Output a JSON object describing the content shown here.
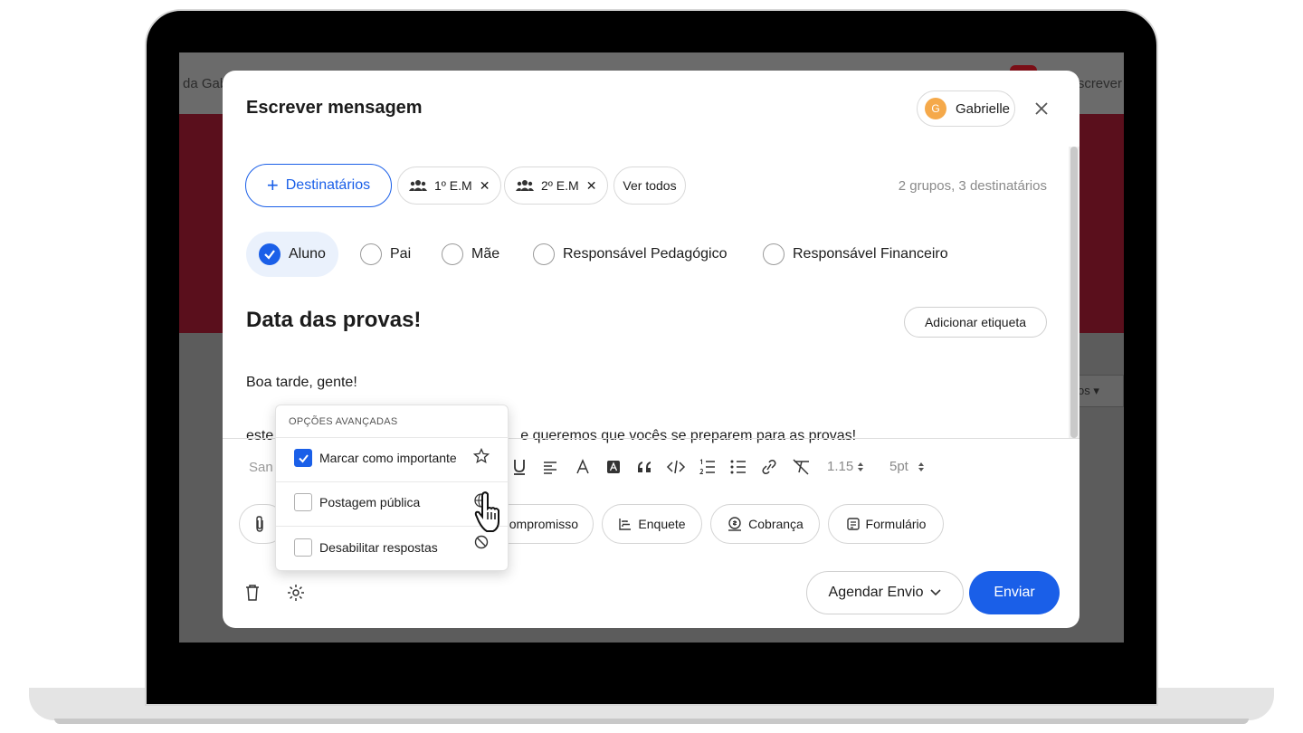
{
  "background": {
    "left_text": "da Gab",
    "right_text": "screver",
    "select_fragment": "os"
  },
  "modal": {
    "title": "Escrever mensagem",
    "user": {
      "avatar_initial": "G",
      "name": "Gabrielle"
    },
    "add_recipients_label": "Destinatários",
    "groups": [
      {
        "label": "1º E.M"
      },
      {
        "label": "2º E.M"
      }
    ],
    "see_all_label": "Ver todos",
    "recipients_summary": "2 grupos, 3 destinatários",
    "roles": [
      {
        "label": "Aluno",
        "checked": true
      },
      {
        "label": "Pai",
        "checked": false
      },
      {
        "label": "Mãe",
        "checked": false
      },
      {
        "label": "Responsável Pedagógico",
        "checked": false
      },
      {
        "label": "Responsável Financeiro",
        "checked": false
      }
    ],
    "message_title": "Data das provas!",
    "add_tag_label": "Adicionar etiqueta",
    "body_line1": "Boa tarde, gente!",
    "body_line2_prefix": "este",
    "body_line2_suffix": "e queremos que vocês se preparem para as provas!",
    "toolbar": {
      "font_fragment": "San",
      "line_height": "1.15",
      "font_size": "5pt"
    },
    "actions": [
      {
        "label": ""
      },
      {
        "label": "ompromisso"
      },
      {
        "label": "Enquete"
      },
      {
        "label": "Cobrança"
      },
      {
        "label": "Formulário"
      }
    ],
    "schedule_label": "Agendar Envio",
    "send_label": "Enviar",
    "accent_color": "#1a5fe8"
  },
  "advanced_options": {
    "header": "OPÇÕES AVANÇADAS",
    "items": [
      {
        "label": "Marcar como importante",
        "checked": true,
        "icon": "star-icon"
      },
      {
        "label": "Postagem pública",
        "checked": false,
        "icon": "globe-icon"
      },
      {
        "label": "Desabilitar respostas",
        "checked": false,
        "icon": "block-icon"
      }
    ]
  }
}
